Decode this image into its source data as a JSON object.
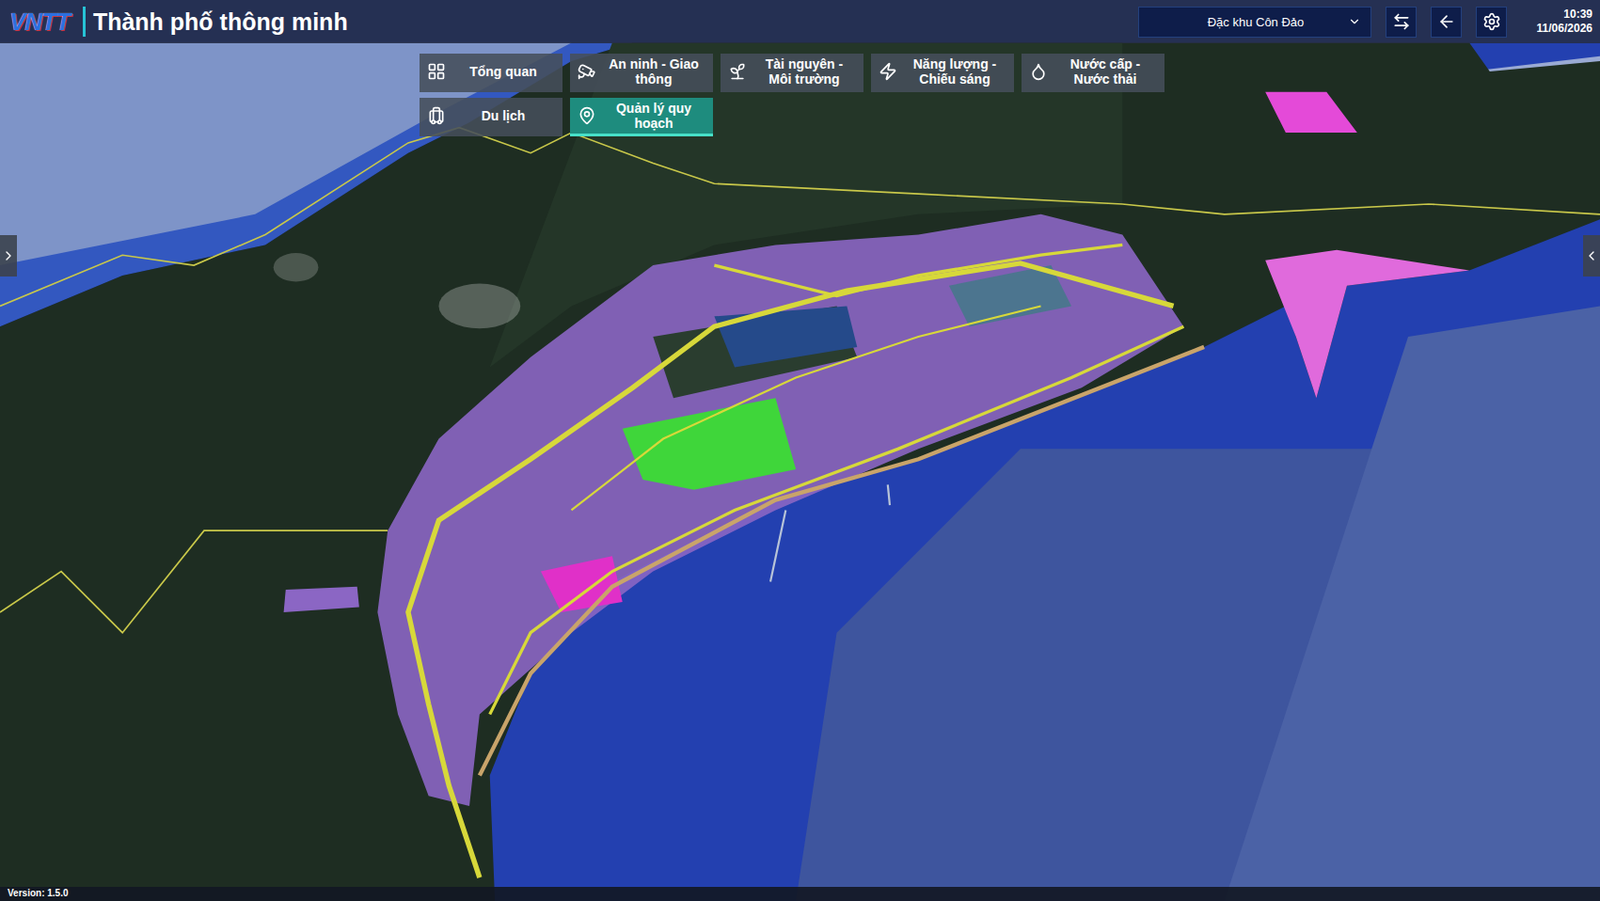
{
  "header": {
    "logo": "VNTT",
    "title": "Thành phố thông minh",
    "district": "Đặc khu Côn Đảo",
    "time": "10:39",
    "date": "11/06/2026"
  },
  "menu": [
    {
      "label": "Tổng quan",
      "selected": false
    },
    {
      "label": "An ninh - Giao thông",
      "selected": false
    },
    {
      "label": "Tài nguyên - Môi trường",
      "selected": false
    },
    {
      "label": "Năng lượng - Chiếu sáng",
      "selected": false
    },
    {
      "label": "Nước cấp - Nước thải",
      "selected": false
    },
    {
      "label": "Du lịch",
      "selected": false
    },
    {
      "label": "Quản lý quy hoạch",
      "selected": true
    }
  ],
  "version": "Version: 1.5.0"
}
